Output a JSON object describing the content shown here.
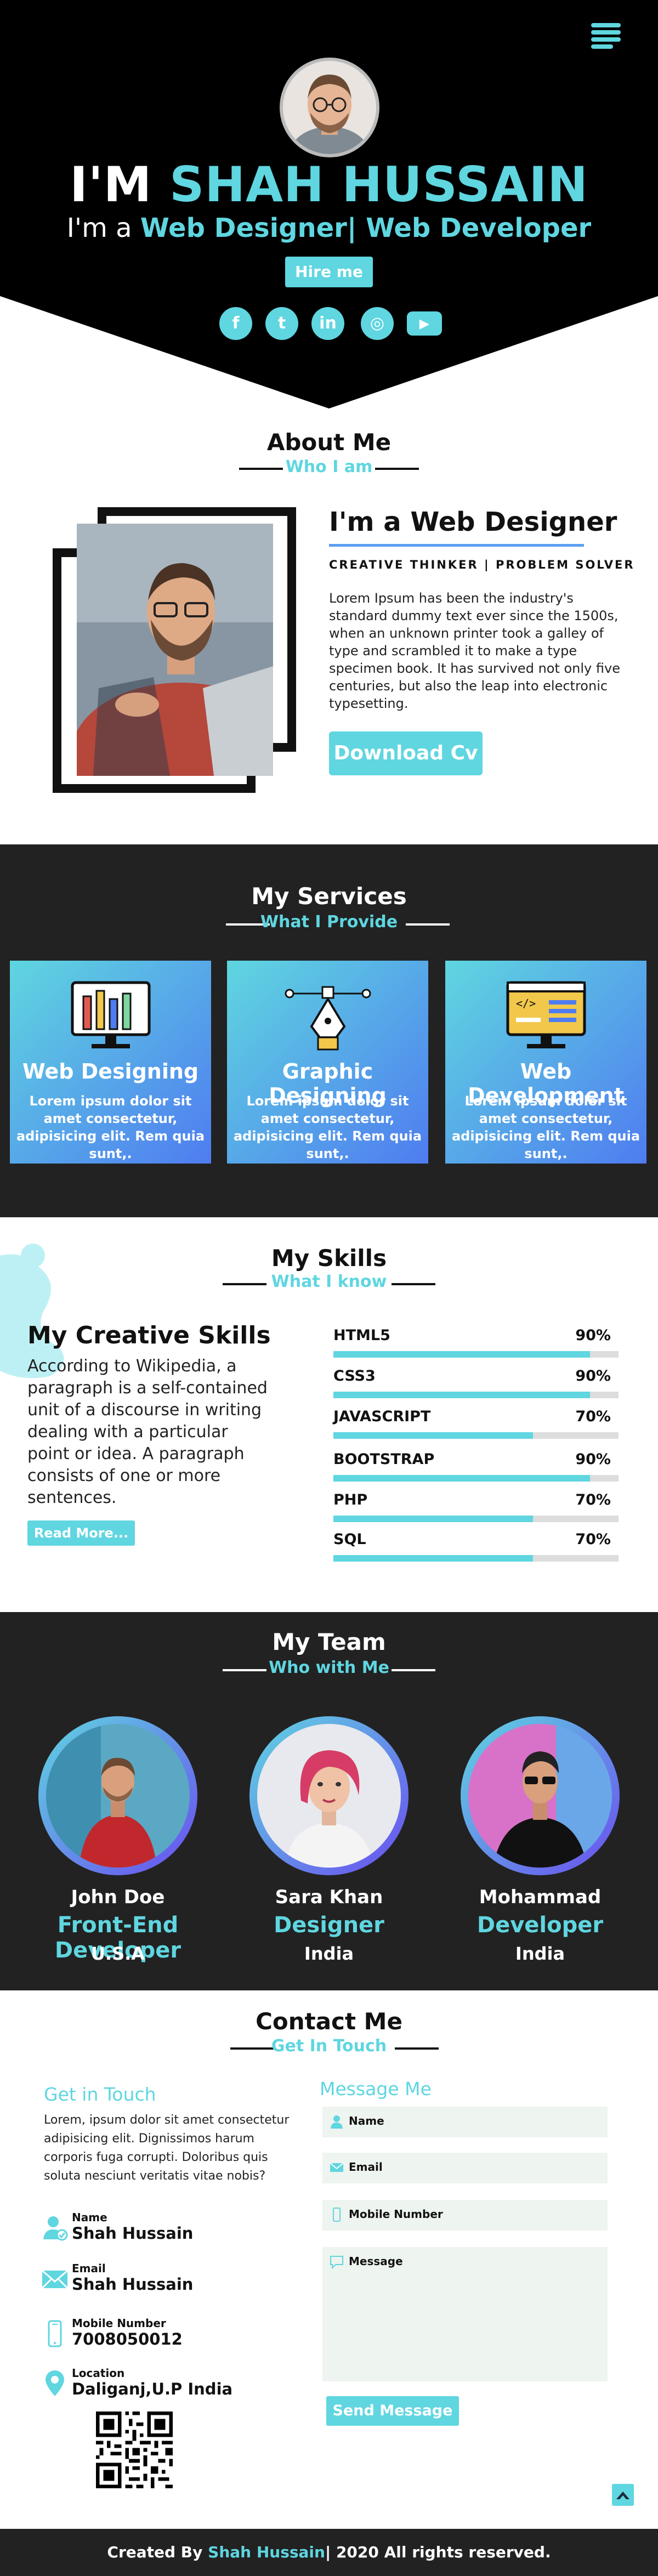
{
  "hero": {
    "title_prefix": "I'M",
    "title_name": "SHAH HUSSAIN",
    "subtitle_prefix": "I'm a",
    "subtitle_roles": "Web Designer| Web Developer",
    "hire_label": "Hire me",
    "social": [
      {
        "icon": "facebook-icon",
        "glyph": "f"
      },
      {
        "icon": "twitter-icon",
        "glyph": "t"
      },
      {
        "icon": "linkedin-icon",
        "glyph": "in"
      },
      {
        "icon": "instagram-icon",
        "glyph": "◎"
      },
      {
        "icon": "youtube-icon",
        "glyph": "▶"
      }
    ]
  },
  "about": {
    "title": "About Me",
    "subtitle": "Who I am",
    "heading": "I'm a Web Designer",
    "tagline": "CREATIVE THINKER | PROBLEM SOLVER",
    "text": "Lorem Ipsum has been the industry's standard dummy text ever since the 1500s, when an unknown printer took a galley of type and scrambled it to make a type specimen book. It has survived not only five centuries, but also the leap into electronic typesetting.",
    "download_label": "Download Cv"
  },
  "services": {
    "title": "My Services",
    "subtitle": "What I Provide",
    "items": [
      {
        "title": "Web Designing",
        "text": "Lorem ipsum dolor sit amet consectetur, adipisicing elit. Rem quia sunt,.",
        "icon": "monitor-design-icon"
      },
      {
        "title": "Graphic Designing",
        "text": "Lorem ipsum dolor sit amet consectetur, adipisicing elit. Rem quia sunt,.",
        "icon": "pen-tool-icon"
      },
      {
        "title": "Web Development",
        "text": "Lorem ipsum dolor sit amet consectetur, adipisicing elit. Rem quia sunt,.",
        "icon": "code-monitor-icon"
      }
    ]
  },
  "skills": {
    "title": "My Skills",
    "subtitle": "What I know",
    "heading": "My Creative  Skills",
    "text": "According to Wikipedia, a paragraph is a self-contained unit of a discourse in writing dealing with a particular point or idea. A paragraph consists of one or more sentences.",
    "readmore_label": "Read More...",
    "items": [
      {
        "name": "HTML5",
        "value": "90%",
        "level": 0.9
      },
      {
        "name": "CSS3",
        "value": "90%",
        "level": 0.9
      },
      {
        "name": "JAVASCRIPT",
        "value": "70%",
        "level": 0.7
      },
      {
        "name": "BOOTSTRAP",
        "value": "90%",
        "level": 0.9
      },
      {
        "name": "PHP",
        "value": "70%",
        "level": 0.7
      },
      {
        "name": "SQL",
        "value": "70%",
        "level": 0.7
      }
    ]
  },
  "team": {
    "title": "My Team",
    "subtitle": "Who with Me",
    "members": [
      {
        "name": "John Doe",
        "role": "Front-End Developer",
        "location": "U.S.A"
      },
      {
        "name": "Sara Khan",
        "role": "Designer",
        "location": "India"
      },
      {
        "name": "Mohammad",
        "role": "Developer",
        "location": "India"
      }
    ]
  },
  "contact": {
    "title": "Contact Me",
    "subtitle": "Get In Touch",
    "get_in_touch": "Get in Touch",
    "text": "Lorem, ipsum dolor sit amet consectetur adipisicing elit. Dignissimos harum corporis fuga corrupti. Doloribus quis soluta nesciunt veritatis vitae nobis?",
    "info": [
      {
        "label": "Name",
        "value": "Shah Hussain",
        "icon": "user-icon"
      },
      {
        "label": "Email",
        "value": "Shah Hussain",
        "icon": "envelope-icon"
      },
      {
        "label": "Mobile Number",
        "value": "7008050012",
        "icon": "phone-icon"
      },
      {
        "label": "Location",
        "value": "Daliganj,U.P India",
        "icon": "location-pin-icon"
      }
    ],
    "message_title": "Message Me",
    "fields": {
      "name": "Name",
      "email": "Email",
      "mobile": "Mobile Number",
      "message": "Message"
    },
    "send_label": "Send Message"
  },
  "footer": {
    "prefix": "Created By",
    "name": "Shah Hussain",
    "suffix": "| 2020 All rights reserved."
  },
  "colors": {
    "accent": "#5fd6e0",
    "dark": "#222222",
    "black": "#000000"
  }
}
